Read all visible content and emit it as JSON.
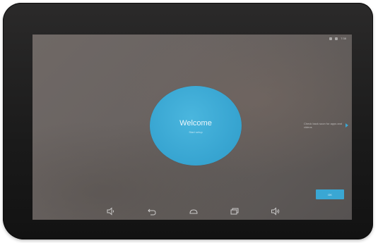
{
  "status_bar": {
    "time": "7:38"
  },
  "welcome": {
    "title": "Welcome",
    "subtitle": "Start setup"
  },
  "hint": {
    "text": "Check back soon for apps and videos"
  },
  "ok_button": {
    "label": "OK"
  },
  "nav_bar": {
    "icons": [
      "volume-down-icon",
      "back-icon",
      "home-icon",
      "recents-icon",
      "volume-up-icon"
    ]
  },
  "colors": {
    "accent": "#3aa7d3",
    "bezel": "#1a1a1a",
    "screen": "#6a6462"
  }
}
